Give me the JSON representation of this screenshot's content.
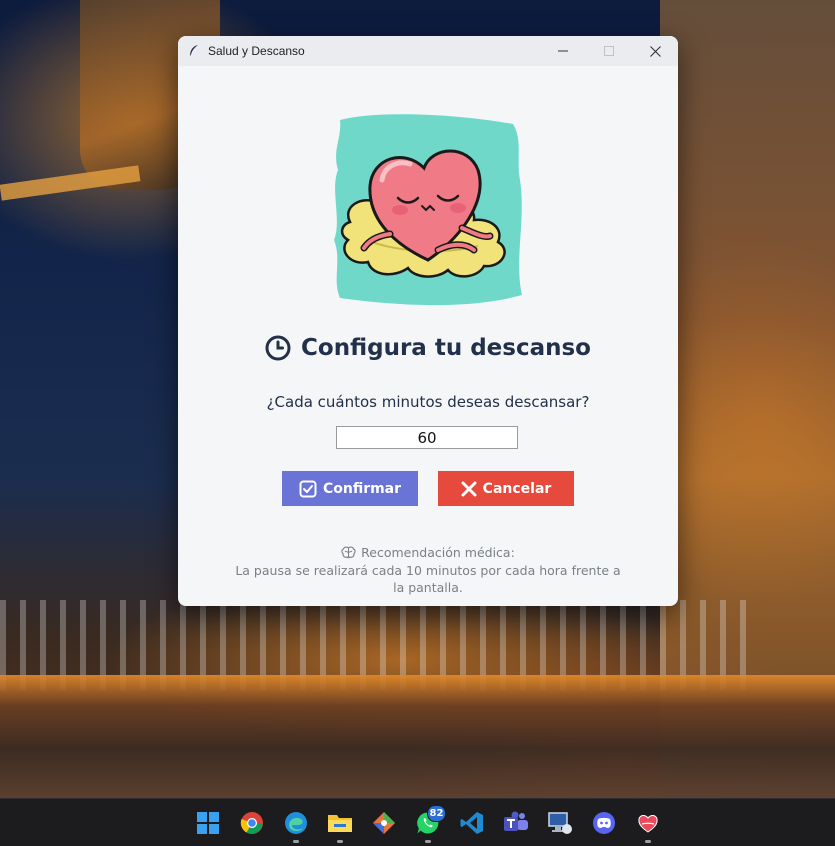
{
  "window": {
    "title": "Salud y Descanso",
    "minimize_icon": "minimize-icon",
    "maximize_icon": "maximize-icon",
    "close_icon": "close-icon"
  },
  "dialog": {
    "illustration": "resting-heart-on-cloud",
    "heading": "Configura tu descanso",
    "heading_icon": "clock-icon",
    "question": "¿Cada cuántos minutos deseas descansar?",
    "minutes_value": "60",
    "confirm_label": "Confirmar",
    "confirm_icon": "checkbox-icon",
    "cancel_label": "Cancelar",
    "cancel_icon": "x-icon",
    "recommendation_title": "Recomendación médica:",
    "recommendation_icon": "brain-icon",
    "recommendation_text": "La pausa se realizará cada 10 minutos por cada hora frente a la pantalla."
  },
  "colors": {
    "confirm_button": "#6a73d6",
    "cancel_button": "#e54a3d",
    "heading_text": "#223049",
    "muted_text": "#7b7f86"
  },
  "taskbar": {
    "items": [
      {
        "name": "windows-start-icon",
        "running": false
      },
      {
        "name": "chrome-icon",
        "running": false
      },
      {
        "name": "edge-icon",
        "running": true
      },
      {
        "name": "file-explorer-icon",
        "running": true
      },
      {
        "name": "git-tool-icon",
        "running": false
      },
      {
        "name": "whatsapp-icon",
        "running": true,
        "badge": "82"
      },
      {
        "name": "vscode-icon",
        "running": false
      },
      {
        "name": "teams-icon",
        "running": false
      },
      {
        "name": "remote-desktop-icon",
        "running": false
      },
      {
        "name": "discord-icon",
        "running": false
      },
      {
        "name": "salud-descanso-app-icon",
        "running": true
      }
    ]
  }
}
